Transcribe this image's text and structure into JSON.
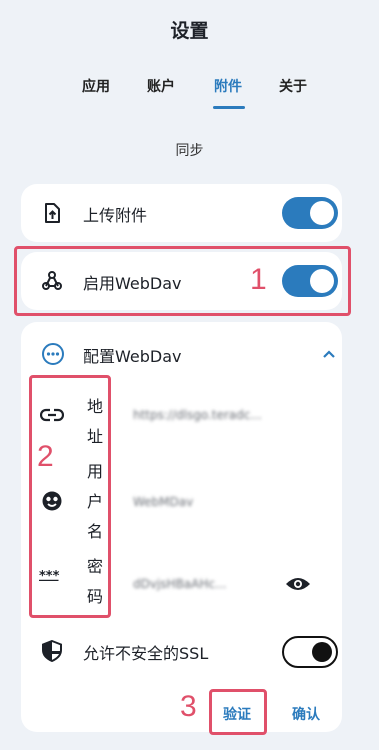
{
  "header": {
    "title": "设置"
  },
  "tabs": [
    {
      "label": "应用"
    },
    {
      "label": "账户"
    },
    {
      "label": "附件",
      "active": true
    },
    {
      "label": "关于"
    }
  ],
  "section": {
    "label": "同步"
  },
  "upload": {
    "label": "上传附件",
    "enabled": true
  },
  "webdav_enable": {
    "label": "启用WebDav",
    "enabled": true
  },
  "webdav_config": {
    "title": "配置WebDav",
    "address_label": "地址",
    "address_value": "https://dlsgo.teradc...",
    "username_label": "用户名",
    "username_value": "WebMDav",
    "password_label": "密码",
    "password_value": "dDvjsHBaAHc..."
  },
  "insecure_ssl": {
    "label": "允许不安全的SSL",
    "enabled": false
  },
  "buttons": {
    "verify": "验证",
    "confirm": "确认"
  },
  "annotations": {
    "one": "1",
    "two": "2",
    "three": "3"
  },
  "colors": {
    "accent": "#2b7bbd",
    "annotation": "#e0506a",
    "background": "#eef2f7"
  }
}
